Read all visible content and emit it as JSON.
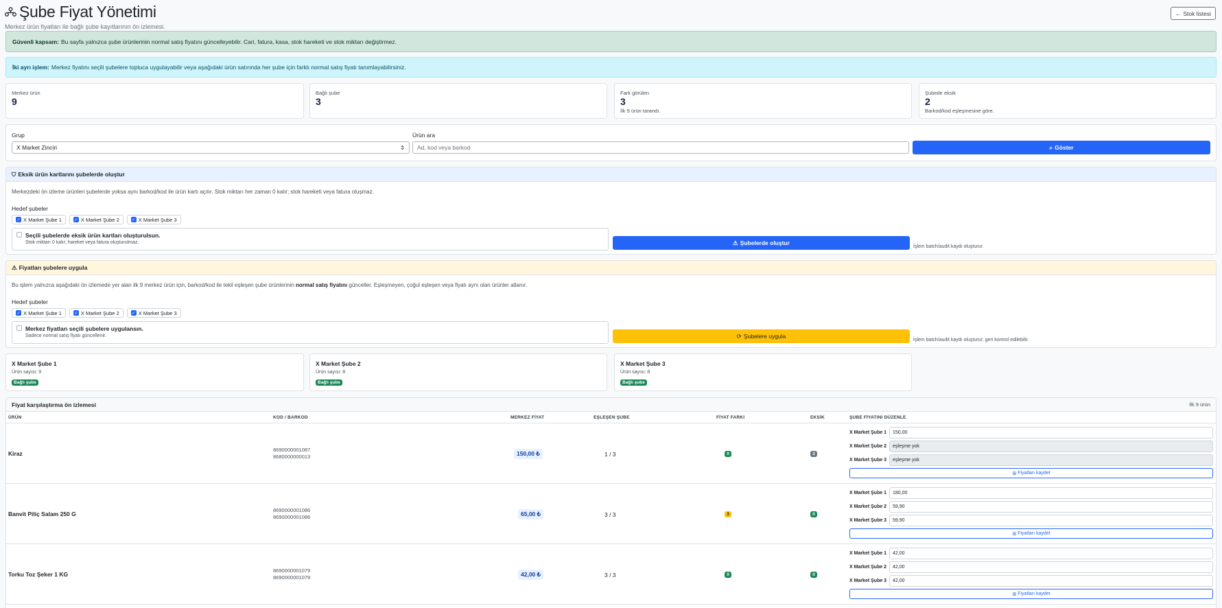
{
  "header": {
    "title": "Şube Fiyat Yönetimi",
    "subtitle": "Merkez ürün fiyatları ile bağlı şube kayıtlarının ön izlemesi.",
    "back_label": "Stok listesi"
  },
  "alerts": {
    "safe_title": "Güvenli kapsam:",
    "safe_text": "Bu sayfa yalnızca şube ürünlerinin normal satış fiyatını güncelleyebilir. Cari, fatura, kasa, stok hareketi ve stok miktarı değiştirmez.",
    "info_title": "İki ayrı işlem:",
    "info_text": "Merkez fiyatını seçili şubelere topluca uygulayabilir veya aşağıdaki ürün satırında her şube için farklı normal satış fiyatı tanımlayabilirsiniz."
  },
  "stats": [
    {
      "label": "Merkez ürün",
      "value": "9",
      "hint": ""
    },
    {
      "label": "Bağlı şube",
      "value": "3",
      "hint": ""
    },
    {
      "label": "Fark görülen",
      "value": "3",
      "hint": "İlk 9 ürün tarandı."
    },
    {
      "label": "Şubede eksik",
      "value": "2",
      "hint": "Barkod/kod eşleşmesine göre."
    }
  ],
  "filter": {
    "group_label": "Grup",
    "group_value": "X Market Zinciri",
    "search_label": "Ürün ara",
    "search_placeholder": "Ad, kod veya barkod",
    "show_button": "Göster"
  },
  "create_card": {
    "title": "Eksik ürün kartlarını şubelerde oluştur",
    "desc": "Merkezdeki ön izleme ürünleri şubelerde yoksa aynı barkod/kod ile ürün kartı açılır. Stok miktarı her zaman 0 kalır; stok hareketi veya fatura oluşmaz.",
    "targets_label": "Hedef şubeler",
    "targets": [
      "X Market Şube 1",
      "X Market Şube 2",
      "X Market Şube 3"
    ],
    "confirm_title": "Seçili şubelerde eksik ürün kartları oluşturulsun.",
    "confirm_sub": "Stok miktarı 0 kalır; hareket veya fatura oluşturulmaz.",
    "action": "Şubelerde oluştur",
    "note": "İşlem batch/audit kaydı oluşturur."
  },
  "apply_card": {
    "title": "Fiyatları şubelere uygula",
    "desc_a": "Bu işlem yalnızca aşağıdaki ön izlemede yer alan ilk 9 merkez ürün için, barkod/kod ile tekil eşleşen şube ürünlerinin",
    "desc_b": "normal satış fiyatını",
    "desc_c": "günceller. Eşleşmeyen, çoğul eşleşen veya fiyatı aynı olan ürünler atlanır.",
    "targets_label": "Hedef şubeler",
    "targets": [
      "X Market Şube 1",
      "X Market Şube 2",
      "X Market Şube 3"
    ],
    "confirm_title": "Merkez fiyatları seçili şubelere uygulansın.",
    "confirm_sub": "Sadece normal satış fiyatı güncellenir.",
    "action": "Şubelere uygula",
    "note": "İşlem batch/audit kaydı oluşturur; geri kontrol edilebilir."
  },
  "branches": [
    {
      "name": "X Market Şube 1",
      "count": "Ürün sayısı: 9",
      "badge": "Bağlı şube"
    },
    {
      "name": "X Market Şube 2",
      "count": "Ürün sayısı: 8",
      "badge": "Bağlı şube"
    },
    {
      "name": "X Market Şube 3",
      "count": "Ürün sayısı: 8",
      "badge": "Bağlı şube"
    }
  ],
  "table": {
    "title": "Fiyat karşılaştırma ön izlemesi",
    "scope": "İlk 9 ürün",
    "columns": [
      "ÜRÜN",
      "KOD / BARKOD",
      "MERKEZ FİYAT",
      "EŞLEŞEN ŞUBE",
      "FİYAT FARKI",
      "EKSİK",
      "ŞUBE FİYATINI DÜZENLE"
    ],
    "rows": [
      {
        "name": "Kiraz",
        "code1": "8690000001087",
        "code2": "8680000000013",
        "price": "150,00 ₺",
        "match": "1 / 3",
        "diff": "0",
        "missing": "2",
        "b1": "X Market Şube 1",
        "v1": "150,00",
        "b2": "X Market Şube 2",
        "v2": "eşleşme yok",
        "b3": "X Market Şube 3",
        "v3": "eşleşme yok",
        "save": "Fiyatları kaydet"
      },
      {
        "name": "Banvit Piliç Salam 250 G",
        "code1": "8690000001086",
        "code2": "8690000001086",
        "price": "65,00 ₺",
        "match": "3 / 3",
        "diff": "3",
        "missing": "0",
        "b1": "X Market Şube 1",
        "v1": "180,00",
        "b2": "X Market Şube 2",
        "v2": "59,90",
        "b3": "X Market Şube 3",
        "v3": "59,90",
        "save": "Fiyatları kaydet"
      },
      {
        "name": "Torku Toz Şeker 1 KG",
        "code1": "8690000001079",
        "code2": "8690000001079",
        "price": "42,00 ₺",
        "match": "3 / 3",
        "diff": "0",
        "missing": "0",
        "b1": "X Market Şube 1",
        "v1": "42,00",
        "b2": "X Market Şube 2",
        "v2": "42,00",
        "b3": "X Market Şube 3",
        "v3": "42,00",
        "save": "Fiyatları kaydet"
      }
    ]
  },
  "colors": {
    "primary": "#2465f8",
    "warning": "#ffc107",
    "success": "#198754"
  }
}
